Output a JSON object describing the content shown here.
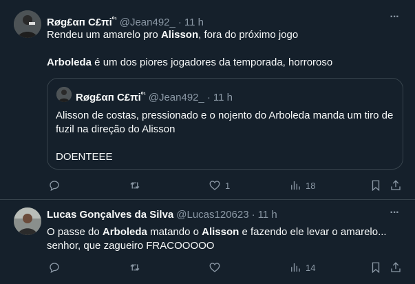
{
  "tweets": [
    {
      "author": {
        "name": "Røg£αп C£πi",
        "sup": "⁰¹",
        "handle": "@Jean492_",
        "time": "11 h"
      },
      "lines": [
        {
          "parts": [
            {
              "t": "Rendeu um amarelo pro "
            },
            {
              "t": "Alisson",
              "b": true
            },
            {
              "t": ", fora do próximo jogo"
            }
          ]
        },
        {
          "parts": [
            {
              "t": "Arboleda",
              "b": true
            },
            {
              "t": " é um dos piores jogadores da temporada, horroroso"
            }
          ]
        }
      ],
      "quote": {
        "author": {
          "name": "Røg£αп C£πi",
          "sup": "⁰¹",
          "handle": "@Jean492_",
          "time": "11 h"
        },
        "line1": "Alisson de costas, pressionado e o nojento do Arboleda manda um tiro de",
        "line2": "fuzil na direção do Alisson",
        "line3": "DOENTEEE"
      },
      "actions": {
        "reply": "",
        "retweet": "",
        "like": "1",
        "views": "18"
      }
    },
    {
      "author": {
        "name": "Lucas Gonçalves da Silva",
        "handle": "@Lucas120623",
        "time": "11 h"
      },
      "lines": [
        {
          "parts": [
            {
              "t": "O passe do "
            },
            {
              "t": "Arboleda",
              "b": true
            },
            {
              "t": " matando o "
            },
            {
              "t": "Alisson",
              "b": true
            },
            {
              "t": " e fazendo ele levar o amarelo..."
            }
          ]
        },
        {
          "parts": [
            {
              "t": "senhor, que zagueiro FRACOOOOO"
            }
          ]
        }
      ],
      "actions": {
        "reply": "",
        "retweet": "",
        "like": "",
        "views": "14"
      }
    }
  ],
  "icons": {
    "more": "more-horizontal-icon",
    "reply": "reply-bubble-icon",
    "retweet": "retweet-arrows-icon",
    "like": "heart-icon",
    "views": "bar-chart-icon",
    "bookmark": "bookmark-icon",
    "share": "share-upload-icon"
  },
  "colors": {
    "background": "#15202b",
    "text": "#f7f9f9",
    "muted": "#8b98a5",
    "border": "#38444d"
  }
}
